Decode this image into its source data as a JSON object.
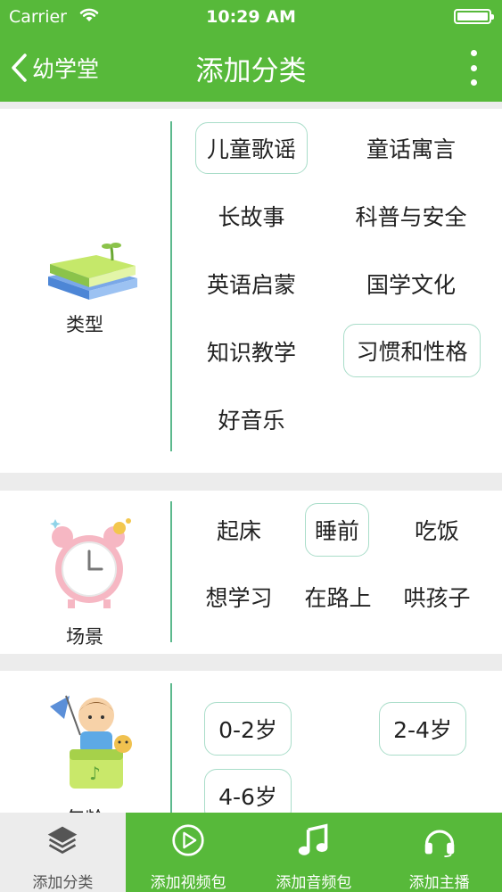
{
  "status_bar": {
    "carrier": "Carrier",
    "time": "10:29 AM"
  },
  "nav": {
    "back_label": "幼学堂",
    "title": "添加分类"
  },
  "sections": {
    "type": {
      "label": "类型",
      "chips": [
        {
          "label": "儿童歌谣",
          "selected": true
        },
        {
          "label": "童话寓言",
          "selected": false
        },
        {
          "label": "长故事",
          "selected": false
        },
        {
          "label": "科普与安全",
          "selected": false
        },
        {
          "label": "英语启蒙",
          "selected": false
        },
        {
          "label": "国学文化",
          "selected": false
        },
        {
          "label": "知识教学",
          "selected": false
        },
        {
          "label": "习惯和性格",
          "selected": true
        },
        {
          "label": "好音乐",
          "selected": false
        }
      ]
    },
    "scene": {
      "label": "场景",
      "chips": [
        {
          "label": "起床",
          "selected": false
        },
        {
          "label": "睡前",
          "selected": true
        },
        {
          "label": "吃饭",
          "selected": false
        },
        {
          "label": "想学习",
          "selected": false
        },
        {
          "label": "在路上",
          "selected": false
        },
        {
          "label": "哄孩子",
          "selected": false
        }
      ]
    },
    "age": {
      "label": "年龄",
      "chips": [
        {
          "label": "0-2岁",
          "selected": true
        },
        {
          "label": "2-4岁",
          "selected": true
        },
        {
          "label": "4-6岁",
          "selected": true
        }
      ]
    }
  },
  "tabs": [
    {
      "label": "添加分类",
      "icon": "layers-icon",
      "active": true
    },
    {
      "label": "添加视频包",
      "icon": "play-circle-icon",
      "active": false
    },
    {
      "label": "添加音频包",
      "icon": "music-note-icon",
      "active": false
    },
    {
      "label": "添加主播",
      "icon": "headphones-icon",
      "active": false
    }
  ],
  "colors": {
    "brand_green": "#57b93a",
    "divider": "#5cb98d",
    "chip_border": "#a9ddc9"
  }
}
